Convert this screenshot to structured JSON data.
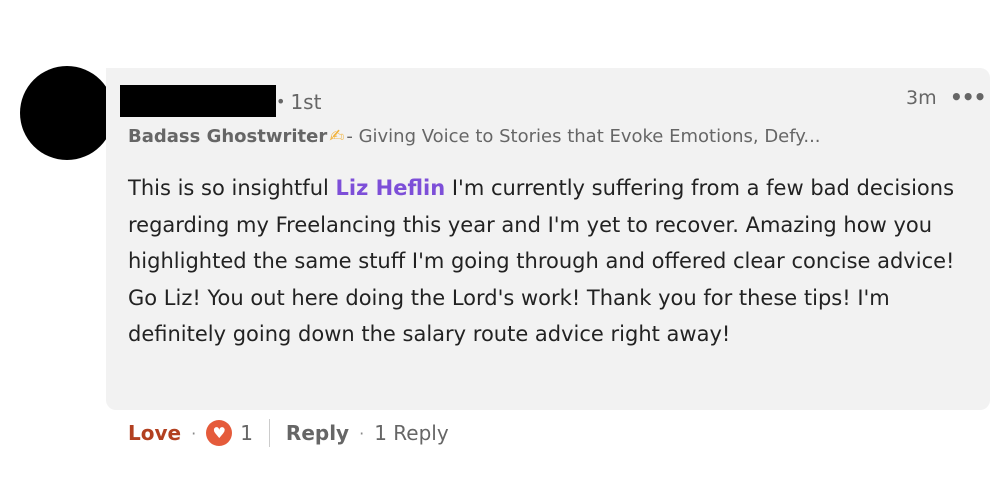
{
  "comment": {
    "degree_label": "1st",
    "timestamp": "3m",
    "more_icon": "ellipsis-horizontal-icon",
    "headline": {
      "role": "Badass Ghostwriter",
      "icon": "writing-hand-icon",
      "separator": "-",
      "tagline": "Giving Voice to Stories that Evoke Emotions, Defy..."
    },
    "text_before_mention": "This is so insightful ",
    "mention": "Liz Heflin",
    "text_after_mention": " I'm currently suffering from a few bad decisions regarding my Freelancing this year and I'm yet to recover. Amazing how you highlighted the same stuff I'm going through and offered clear concise advice! Go Liz! You out here doing the Lord's work! Thank you for these tips! I'm definitely going down the salary route advice right away!"
  },
  "actions": {
    "love_label": "Love",
    "reaction_count": "1",
    "reply_label": "Reply",
    "replies_label": "1 Reply"
  },
  "colors": {
    "bubble_bg": "#f2f2f2",
    "mention": "#7d4fd8",
    "love": "#b24020",
    "heart_badge": "#e55b3b"
  }
}
